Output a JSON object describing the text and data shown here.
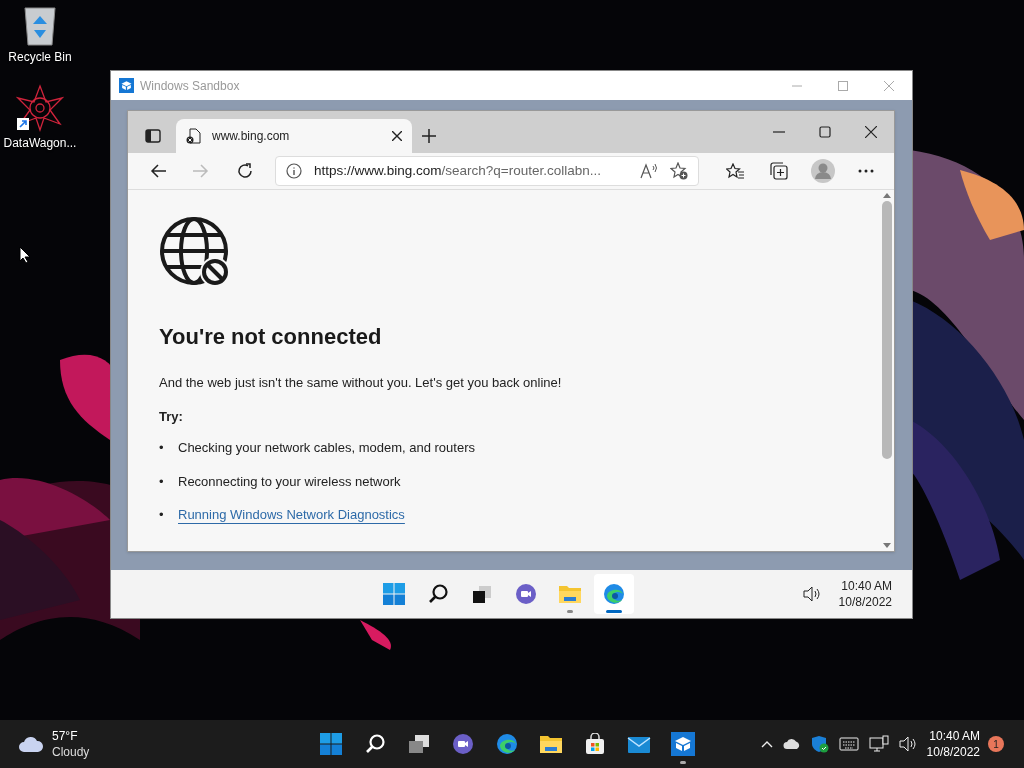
{
  "desktop_icons": [
    {
      "kind": "recycle",
      "label": "Recycle Bin"
    },
    {
      "kind": "shortcut",
      "label": "DataWagon..."
    }
  ],
  "sandbox": {
    "title": "Windows Sandbox",
    "browser": {
      "tab": {
        "title": "www.bing.com"
      },
      "address": {
        "host": "https://www.bing.com",
        "rest": "/search?q=router.collabn..."
      },
      "page": {
        "heading": "You're not connected",
        "message": "And the web just isn't the same without you. Let's get you back online!",
        "try_label": "Try:",
        "suggestions": [
          {
            "kind": "text",
            "bullet": "•",
            "text": "Checking your network cables, modem, and routers"
          },
          {
            "kind": "text",
            "bullet": "•",
            "text": "Reconnecting to your wireless network"
          },
          {
            "kind": "link",
            "bullet": "•",
            "text": "Running Windows Network Diagnostics"
          }
        ]
      }
    },
    "taskbar": {
      "apps": [
        {
          "kind": "start",
          "running": false,
          "active": false
        },
        {
          "kind": "search",
          "running": false,
          "active": false
        },
        {
          "kind": "taskview",
          "running": false,
          "active": false
        },
        {
          "kind": "chat",
          "running": false,
          "active": false
        },
        {
          "kind": "explorer",
          "running": true,
          "active": false
        },
        {
          "kind": "edge",
          "running": true,
          "active": true
        }
      ],
      "time": "10:40 AM",
      "date": "10/8/2022"
    }
  },
  "taskbar": {
    "weather": {
      "temperature": "57°F",
      "condition": "Cloudy"
    },
    "apps": [
      {
        "kind": "start",
        "running": false
      },
      {
        "kind": "search",
        "running": false
      },
      {
        "kind": "taskview",
        "running": false
      },
      {
        "kind": "chat",
        "running": false
      },
      {
        "kind": "edge",
        "running": false
      },
      {
        "kind": "explorer",
        "running": false
      },
      {
        "kind": "store",
        "running": false
      },
      {
        "kind": "mail",
        "running": false
      },
      {
        "kind": "sandbox",
        "running": true
      }
    ],
    "time": "10:40 AM",
    "date": "10/8/2022",
    "notifications": "1"
  }
}
